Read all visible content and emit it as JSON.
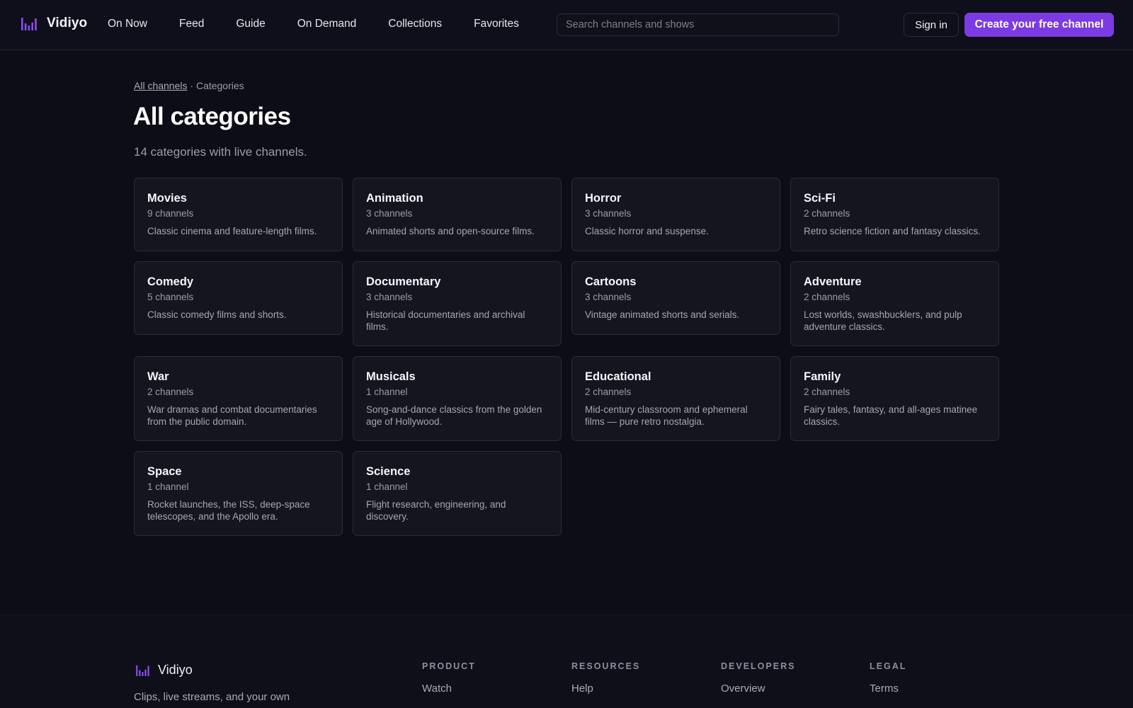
{
  "brand": {
    "name": "Vidiyo",
    "accent": "#7b3ae2",
    "logo_icon": "equalizer-bars-icon"
  },
  "nav": [
    {
      "label": "On Now"
    },
    {
      "label": "Feed"
    },
    {
      "label": "Guide"
    },
    {
      "label": "On Demand"
    },
    {
      "label": "Collections"
    },
    {
      "label": "Favorites"
    }
  ],
  "search": {
    "placeholder": "Search channels and shows",
    "value": ""
  },
  "header_actions": {
    "signin_label": "Sign in",
    "cta_label": "Create your free channel"
  },
  "breadcrumb": {
    "link_label": "All channels",
    "separator": "·",
    "current": "Categories"
  },
  "page": {
    "title": "All categories",
    "subtitle": "14 categories with live channels."
  },
  "categories": [
    {
      "title": "Movies",
      "count": "9 channels",
      "desc": "Classic cinema and feature-length films."
    },
    {
      "title": "Animation",
      "count": "3 channels",
      "desc": "Animated shorts and open-source films."
    },
    {
      "title": "Horror",
      "count": "3 channels",
      "desc": "Classic horror and suspense."
    },
    {
      "title": "Sci-Fi",
      "count": "2 channels",
      "desc": "Retro science fiction and fantasy classics."
    },
    {
      "title": "Comedy",
      "count": "5 channels",
      "desc": "Classic comedy films and shorts."
    },
    {
      "title": "Documentary",
      "count": "3 channels",
      "desc": "Historical documentaries and archival films."
    },
    {
      "title": "Cartoons",
      "count": "3 channels",
      "desc": "Vintage animated shorts and serials."
    },
    {
      "title": "Adventure",
      "count": "2 channels",
      "desc": "Lost worlds, swashbucklers, and pulp adventure classics."
    },
    {
      "title": "War",
      "count": "2 channels",
      "desc": "War dramas and combat documentaries from the public domain."
    },
    {
      "title": "Musicals",
      "count": "1 channel",
      "desc": "Song-and-dance classics from the golden age of Hollywood."
    },
    {
      "title": "Educational",
      "count": "2 channels",
      "desc": "Mid-century classroom and ephemeral films — pure retro nostalgia."
    },
    {
      "title": "Family",
      "count": "2 channels",
      "desc": "Fairy tales, fantasy, and all-ages matinee classics."
    },
    {
      "title": "Space",
      "count": "1 channel",
      "desc": "Rocket launches, the ISS, deep-space telescopes, and the Apollo era."
    },
    {
      "title": "Science",
      "count": "1 channel",
      "desc": "Flight research, engineering, and discovery."
    }
  ],
  "footer": {
    "brand_name": "Vidiyo",
    "tagline": "Clips, live streams, and your own",
    "columns": [
      {
        "heading": "PRODUCT",
        "links": [
          "Watch"
        ]
      },
      {
        "heading": "RESOURCES",
        "links": [
          "Help"
        ]
      },
      {
        "heading": "DEVELOPERS",
        "links": [
          "Overview"
        ]
      },
      {
        "heading": "LEGAL",
        "links": [
          "Terms"
        ]
      }
    ]
  }
}
